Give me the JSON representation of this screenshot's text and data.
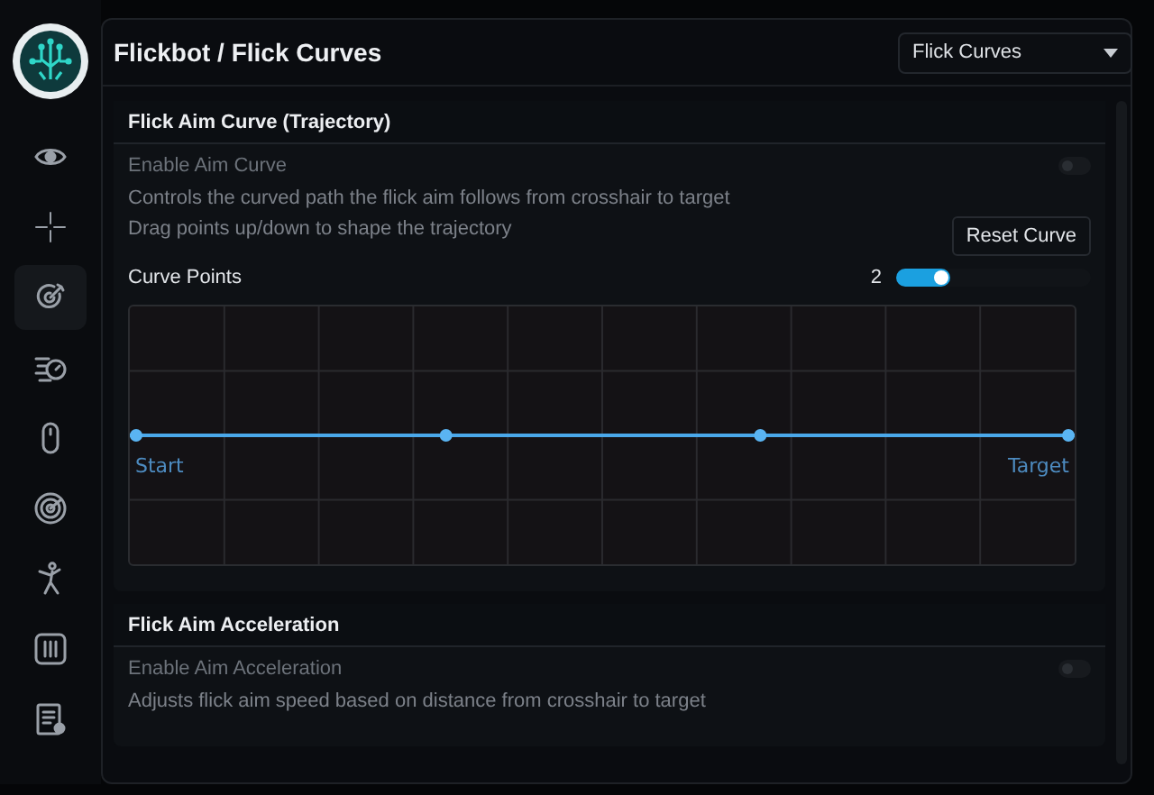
{
  "sidebar": {
    "items": [
      {
        "kind": "eye",
        "selected": false
      },
      {
        "kind": "crosshair",
        "selected": false
      },
      {
        "kind": "target",
        "selected": true
      },
      {
        "kind": "speed",
        "selected": false
      },
      {
        "kind": "mouse",
        "selected": false
      },
      {
        "kind": "radar",
        "selected": false
      },
      {
        "kind": "figure",
        "selected": false
      },
      {
        "kind": "sliders",
        "selected": false
      },
      {
        "kind": "log",
        "selected": false
      }
    ]
  },
  "header": {
    "title": "Flickbot / Flick Curves",
    "dropdown": {
      "value": "Flick Curves"
    }
  },
  "sections": [
    {
      "title": "Flick Aim Curve (Trajectory)",
      "toggle": {
        "label": "Enable Aim Curve",
        "on": false
      },
      "descriptions": [
        "Controls the curved path the flick aim follows from crosshair to target",
        "Drag points up/down to shape the trajectory"
      ],
      "button": "Reset Curve",
      "slider": {
        "label": "Curve Points",
        "value": "2",
        "level": 0.28
      },
      "curve": {
        "start_label": "Start",
        "end_label": "Target"
      }
    },
    {
      "title": "Flick Aim Acceleration",
      "toggle": {
        "label": "Enable Aim Acceleration",
        "on": false
      },
      "descriptions": [
        "Adjusts flick aim speed based on distance from crosshair to target"
      ]
    }
  ]
}
